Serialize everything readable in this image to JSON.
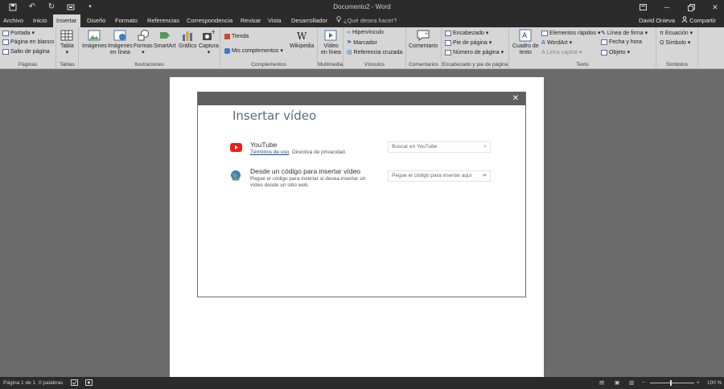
{
  "window": {
    "title": "Documento2 - Word",
    "user": "David Onieva",
    "share": "Compartir"
  },
  "tabs": [
    {
      "label": "Archivo"
    },
    {
      "label": "Inicio"
    },
    {
      "label": "Insertar",
      "active": true
    },
    {
      "label": "Diseño"
    },
    {
      "label": "Formato"
    },
    {
      "label": "Referencias"
    },
    {
      "label": "Correspondencia"
    },
    {
      "label": "Revisar"
    },
    {
      "label": "Vista"
    },
    {
      "label": "Desarrollador"
    }
  ],
  "tellme": "¿Qué desea hacer?",
  "ribbon": {
    "paginas": {
      "name": "Páginas",
      "items": [
        "Portada",
        "Página en blanco",
        "Salto de página"
      ]
    },
    "tablas": {
      "name": "Tablas",
      "tabla": "Tabla"
    },
    "ilustraciones": {
      "name": "Ilustraciones",
      "imagenes": "Imágenes",
      "imagenes_linea_1": "Imágenes",
      "imagenes_linea_2": "en línea",
      "formas": "Formas",
      "smartart": "SmartArt",
      "grafico": "Gráfico",
      "captura": "Captura"
    },
    "complementos": {
      "name": "Complementos",
      "tienda": "Tienda",
      "mis": "Mis complementos",
      "wikipedia": "Wikipedia"
    },
    "multimedia": {
      "name": "Multimedia",
      "video_1": "Vídeo",
      "video_2": "en línea"
    },
    "vinculos": {
      "name": "Vínculos",
      "items": [
        "Hipervínculo",
        "Marcador",
        "Referencia cruzada"
      ]
    },
    "comentarios": {
      "name": "Comentarios",
      "comentario": "Comentario"
    },
    "encabezado": {
      "name": "Encabezado y pie de página",
      "items": [
        "Encabezado",
        "Pie de página",
        "Número de página"
      ]
    },
    "texto": {
      "name": "Texto",
      "cuadro_1": "Cuadro de",
      "cuadro_2": "texto",
      "items": [
        "Elementos rápidos",
        "WordArt",
        "Letra capital"
      ],
      "items2": [
        "Línea de firma",
        "Fecha y hora",
        "Objeto"
      ]
    },
    "simbolos": {
      "name": "Símbolos",
      "items": [
        "Ecuación",
        "Símbolo"
      ]
    }
  },
  "dialog": {
    "title": "Insertar vídeo",
    "youtube": {
      "name": "YouTube",
      "terms": "Términos de uso",
      "privacy": ". Directiva de privacidad.",
      "placeholder": "Buscar en YouTube"
    },
    "embed": {
      "name": "Desde un código para insertar vídeo",
      "desc_1": "Pegue el código para insertar si desea insertar un",
      "desc_2": "vídeo desde un sitio web.",
      "placeholder": "Pegue el código para insertar aquí"
    }
  },
  "status": {
    "page": "Página 1 de 1",
    "words": "0 palabras",
    "zoom": "100 %",
    "zoom_level_percent": 100
  },
  "colors": {
    "titlebar": "#2b2b2b",
    "ribbon": "#d6d6d6",
    "docbg": "#6b6b6b",
    "youtube_red": "#e62117",
    "dialog_title": "#5a6a80"
  }
}
